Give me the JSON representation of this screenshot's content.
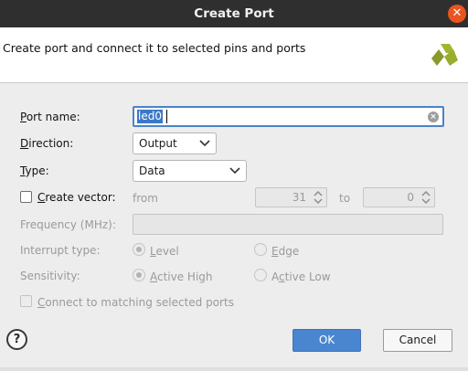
{
  "window": {
    "title": "Create Port",
    "close_glyph": "✕"
  },
  "header": {
    "description": "Create port and connect it to selected pins and ports"
  },
  "form": {
    "port_name": {
      "label_mnemonic": "P",
      "label_rest": "ort name:",
      "value": "led0"
    },
    "direction": {
      "label_mnemonic": "D",
      "label_rest": "irection:",
      "value": "Output"
    },
    "type": {
      "label_mnemonic": "T",
      "label_rest": "ype:",
      "value": "Data"
    },
    "create_vector": {
      "label_mnemonic": "C",
      "label_rest": "reate vector:",
      "checked": false,
      "from_label": "from",
      "from_value": "31",
      "to_label": "to",
      "to_value": "0"
    },
    "frequency": {
      "label": "Frequency (MHz):",
      "value": ""
    },
    "interrupt_type": {
      "label": "Interrupt type:",
      "options": [
        {
          "mnemonic": "L",
          "rest": "evel",
          "selected": true
        },
        {
          "mnemonic": "E",
          "rest": "dge",
          "selected": false
        }
      ]
    },
    "sensitivity": {
      "label": "Sensitivity:",
      "options": [
        {
          "prefix": "",
          "mnemonic": "A",
          "rest": "ctive High",
          "selected": true
        },
        {
          "prefix": "A",
          "mnemonic": "c",
          "rest": "tive Low",
          "selected": false
        }
      ]
    },
    "connect_matching": {
      "mnemonic": "C",
      "rest": "onnect to matching selected ports",
      "checked": false
    }
  },
  "buttons": {
    "help": "?",
    "ok": "OK",
    "cancel": "Cancel"
  },
  "colors": {
    "title_bar": "#2f2f2f",
    "close_button": "#e95420",
    "accent": "#4a86cf",
    "selection": "#3c78c8"
  }
}
